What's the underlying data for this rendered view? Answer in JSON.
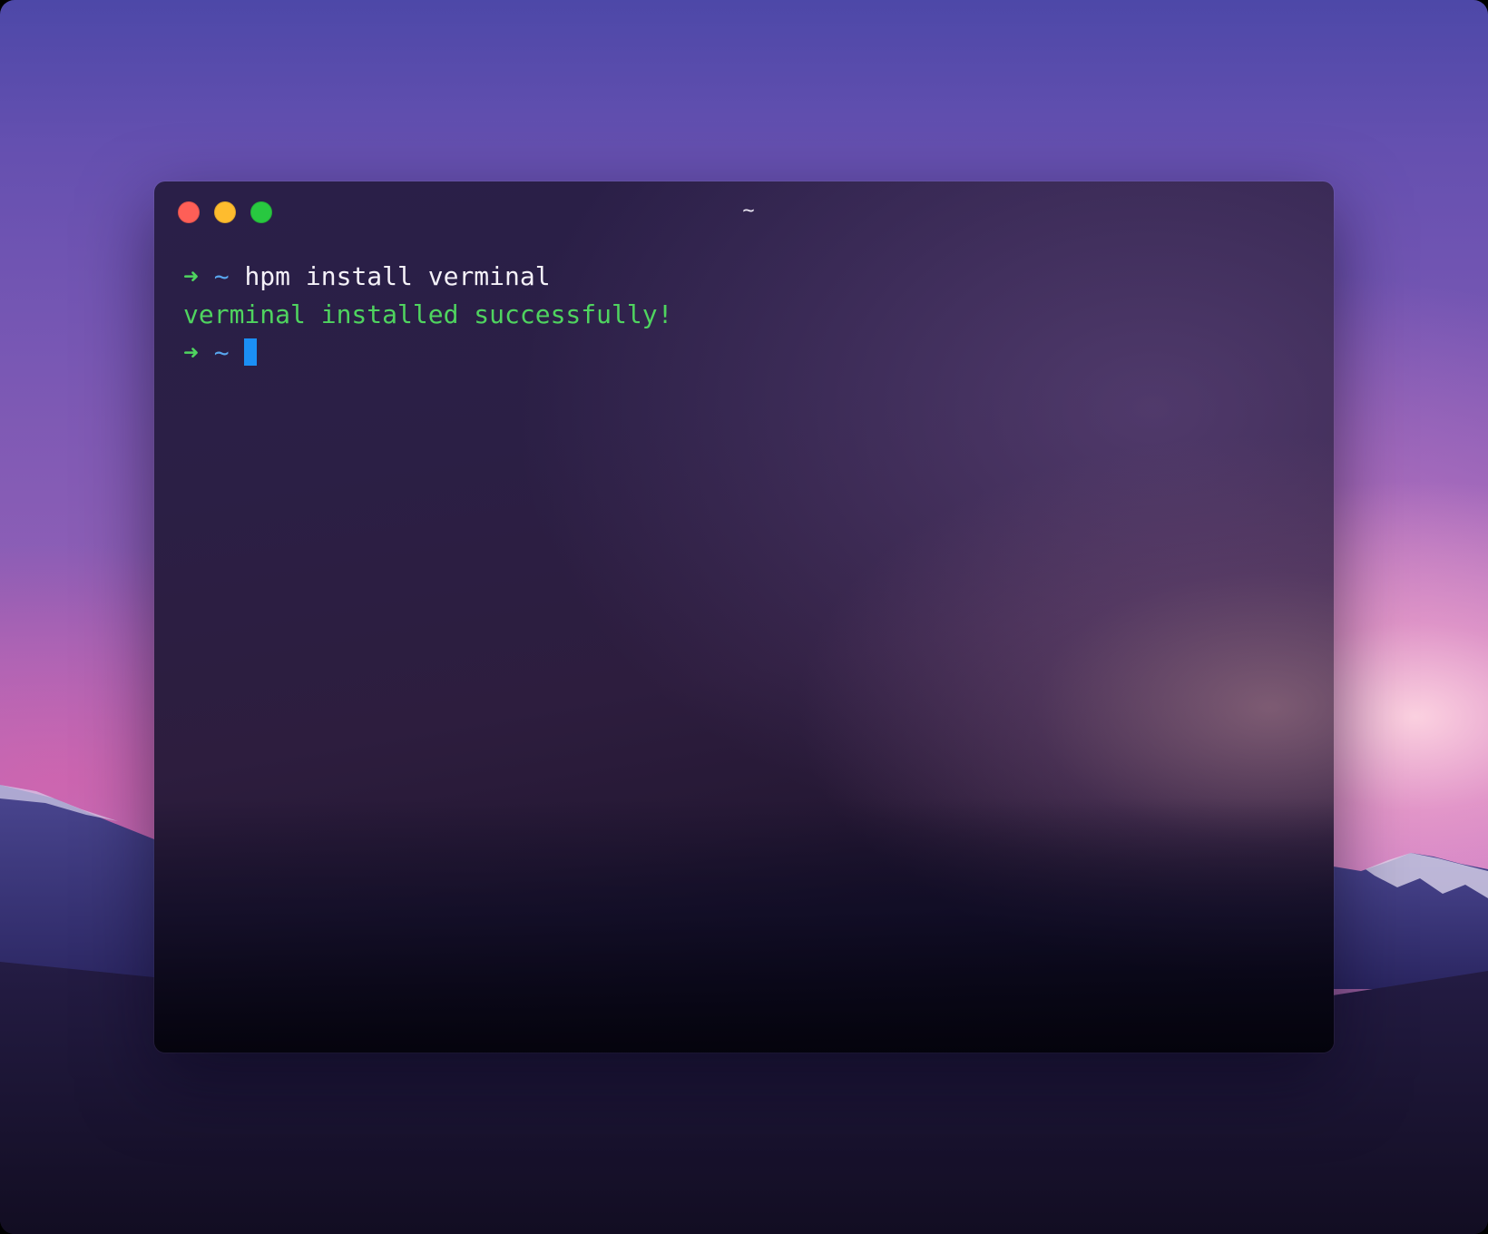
{
  "window": {
    "title": "~"
  },
  "terminal": {
    "lines": [
      {
        "prompt_arrow": "➜",
        "prompt_path": "~",
        "command": "hpm install verminal"
      },
      {
        "output": "verminal installed successfully!"
      },
      {
        "prompt_arrow": "➜",
        "prompt_path": "~",
        "command": ""
      }
    ]
  },
  "colors": {
    "prompt_arrow": "#4fd45f",
    "prompt_path": "#58a6ee",
    "output_success": "#4fd45f",
    "cursor": "#1b8ff5",
    "close_button": "#fe5f57",
    "minimize_button": "#febc2e",
    "maximize_button": "#28c840"
  },
  "icons": {
    "close": "close-button-icon",
    "minimize": "minimize-button-icon",
    "maximize": "maximize-button-icon"
  }
}
